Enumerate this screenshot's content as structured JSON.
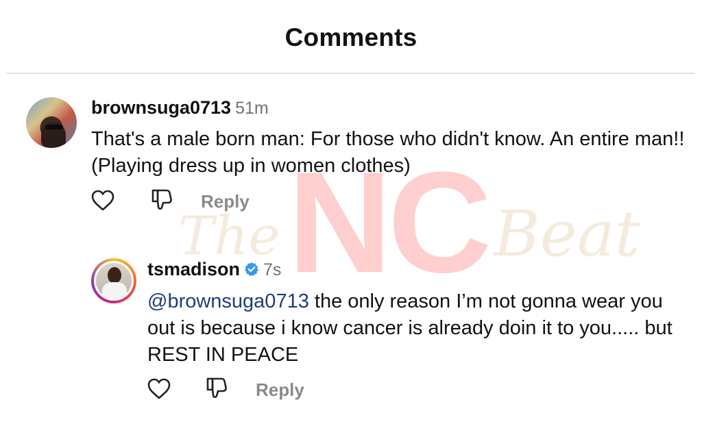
{
  "header": {
    "title": "Comments"
  },
  "watermark": {
    "main": "NC",
    "left_script": "The",
    "right_script": "Beat"
  },
  "comments": [
    {
      "username": "brownsuga0713",
      "timestamp": "51m",
      "verified": false,
      "text": "That's a male born man: For those who didn't know. An entire man!! (Playing dress up in women clothes)",
      "reply_label": "Reply",
      "like_icon": "heart-icon",
      "dislike_icon": "thumbs-down-icon"
    },
    {
      "username": "tsmadison",
      "timestamp": "7s",
      "verified": true,
      "mention": "@brownsuga0713",
      "text": " the only reason I’m not gonna wear you out is because i know cancer is already doin it to you..... but REST IN PEACE",
      "reply_label": "Reply",
      "like_icon": "heart-icon",
      "dislike_icon": "thumbs-down-icon"
    }
  ],
  "colors": {
    "mention": "#1f3d7a",
    "verified": "#3897f0",
    "muted": "#737373",
    "divider": "#e2e2e2"
  }
}
